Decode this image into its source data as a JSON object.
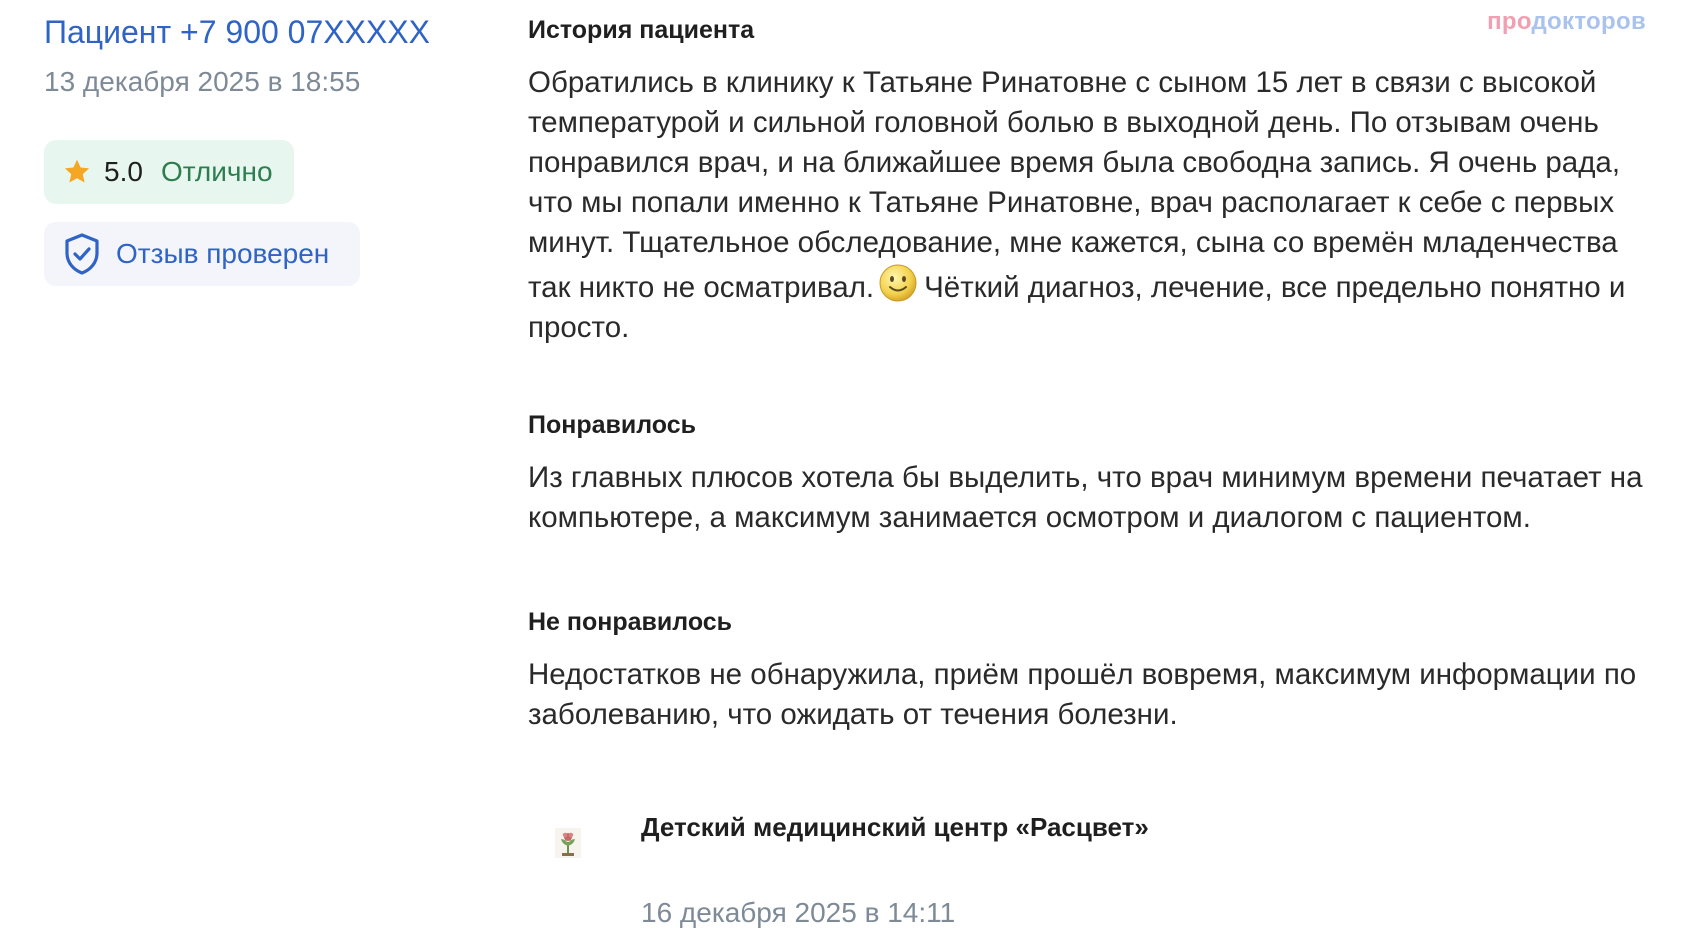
{
  "review": {
    "author": "Пациент +7 900 07XXXXX",
    "date": "13 декабря 2025 в 18:55",
    "rating": {
      "score": "5.0",
      "label": "Отлично"
    },
    "verified_label": "Отзыв проверен"
  },
  "brand": {
    "part1": "про",
    "part2": "докторов"
  },
  "sections": {
    "history": {
      "title": "История пациента",
      "text_before_emoji": "Обратились в клинику к Татьяне Ринатовне с сыном 15 лет в связи с высокой температурой и сильной головной болью в выходной день. По отзывам очень понравился врач, и на ближайшее время была свободна запись. Я очень рада, что мы попали именно к Татьяне Ринатовне, врач располагает к себе с первых минут. Тщательное обследование, мне кажется, сына со времён младенчества так никто не осматривал.",
      "emoji": "smiley-emoji",
      "text_after_emoji": "Чёткий диагноз, лечение, все предельно понятно и просто."
    },
    "liked": {
      "title": "Понравилось",
      "text": "Из главных плюсов хотела бы выделить, что врач минимум времени печатает на компьютере, а максимум занимается осмотром и диалогом с пациентом."
    },
    "disliked": {
      "title": "Не понравилось",
      "text": "Недостатков не обнаружила, приём прошёл вовремя, максимум информации по заболеванию, что ожидать от течения болезни."
    }
  },
  "reply": {
    "clinic_name": "Детский медицинский центр «Расцвет»",
    "clinic_icon": "clinic-logo-icon",
    "date": "16 декабря 2025 в 14:11"
  },
  "colors": {
    "link_blue": "#2f63c6",
    "muted_gray": "#7e8a96",
    "rating_bg": "#e7f6ee",
    "rating_text": "#2e7d4f",
    "star": "#f5a623",
    "verified_bg": "#f3f5fa"
  }
}
